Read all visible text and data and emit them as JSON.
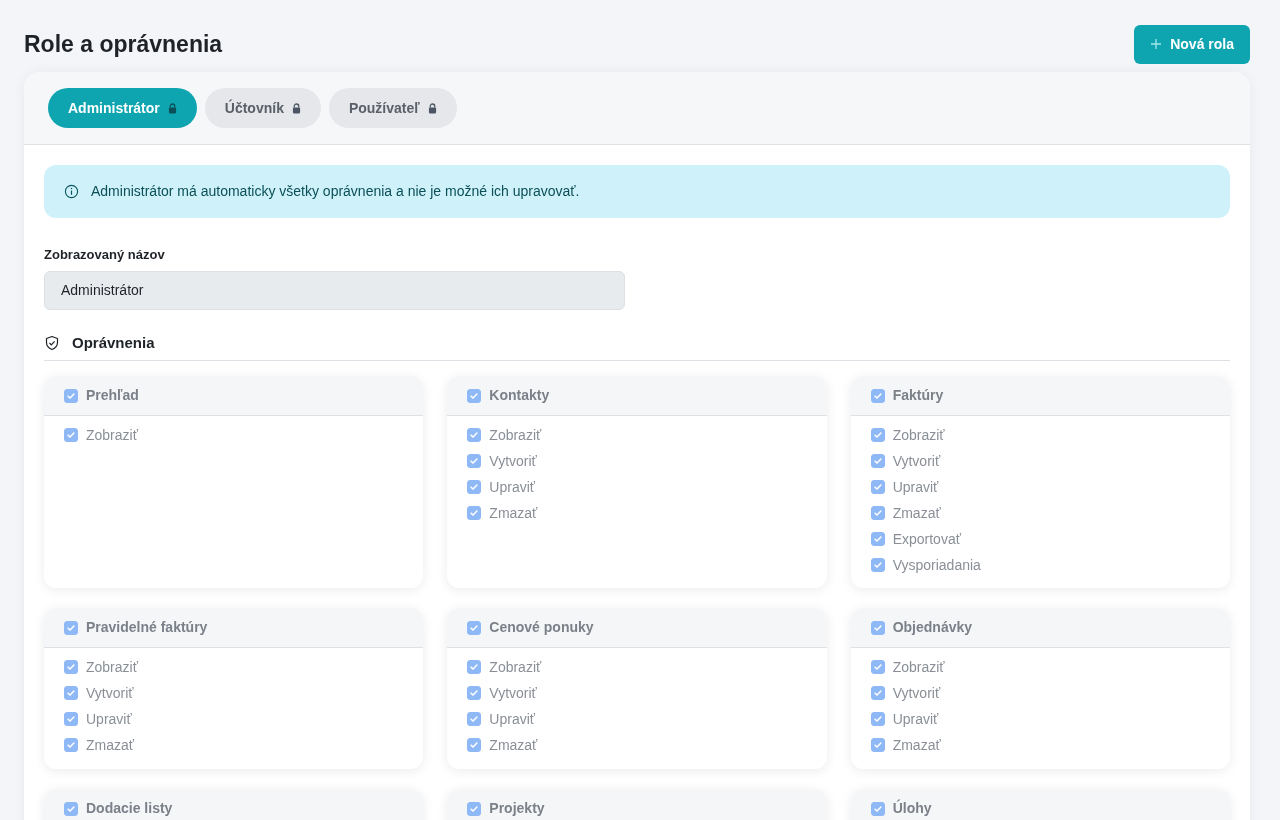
{
  "page": {
    "title": "Role a oprávnenia",
    "new_button": {
      "label": "Nová rola"
    }
  },
  "tabs": [
    {
      "label": "Administrátor",
      "selected": true,
      "locked": true
    },
    {
      "label": "Účtovník",
      "selected": false,
      "locked": true
    },
    {
      "label": "Používateľ",
      "selected": false,
      "locked": true
    }
  ],
  "notice": {
    "text": "Administrátor má automaticky všetky oprávnenia a nie je možné ich upravovať."
  },
  "name_field": {
    "label": "Zobrazovaný názov",
    "value": "Administrátor",
    "disabled": true
  },
  "permissions": {
    "title": "Oprávnenia",
    "disabled": true,
    "groups": [
      {
        "label": "Prehľad",
        "checked": true,
        "items": [
          {
            "label": "Zobraziť",
            "checked": true
          }
        ]
      },
      {
        "label": "Kontakty",
        "checked": true,
        "items": [
          {
            "label": "Zobraziť",
            "checked": true
          },
          {
            "label": "Vytvoriť",
            "checked": true
          },
          {
            "label": "Upraviť",
            "checked": true
          },
          {
            "label": "Zmazať",
            "checked": true
          }
        ]
      },
      {
        "label": "Faktúry",
        "checked": true,
        "items": [
          {
            "label": "Zobraziť",
            "checked": true
          },
          {
            "label": "Vytvoriť",
            "checked": true
          },
          {
            "label": "Upraviť",
            "checked": true
          },
          {
            "label": "Zmazať",
            "checked": true
          },
          {
            "label": "Exportovať",
            "checked": true
          },
          {
            "label": "Vysporiadania",
            "checked": true
          }
        ]
      },
      {
        "label": "Pravidelné faktúry",
        "checked": true,
        "items": [
          {
            "label": "Zobraziť",
            "checked": true
          },
          {
            "label": "Vytvoriť",
            "checked": true
          },
          {
            "label": "Upraviť",
            "checked": true
          },
          {
            "label": "Zmazať",
            "checked": true
          }
        ]
      },
      {
        "label": "Cenové ponuky",
        "checked": true,
        "items": [
          {
            "label": "Zobraziť",
            "checked": true
          },
          {
            "label": "Vytvoriť",
            "checked": true
          },
          {
            "label": "Upraviť",
            "checked": true
          },
          {
            "label": "Zmazať",
            "checked": true
          }
        ]
      },
      {
        "label": "Objednávky",
        "checked": true,
        "items": [
          {
            "label": "Zobraziť",
            "checked": true
          },
          {
            "label": "Vytvoriť",
            "checked": true
          },
          {
            "label": "Upraviť",
            "checked": true
          },
          {
            "label": "Zmazať",
            "checked": true
          }
        ]
      },
      {
        "label": "Dodacie listy",
        "checked": true
      },
      {
        "label": "Projekty",
        "checked": true
      },
      {
        "label": "Úlohy",
        "checked": true
      }
    ]
  }
}
